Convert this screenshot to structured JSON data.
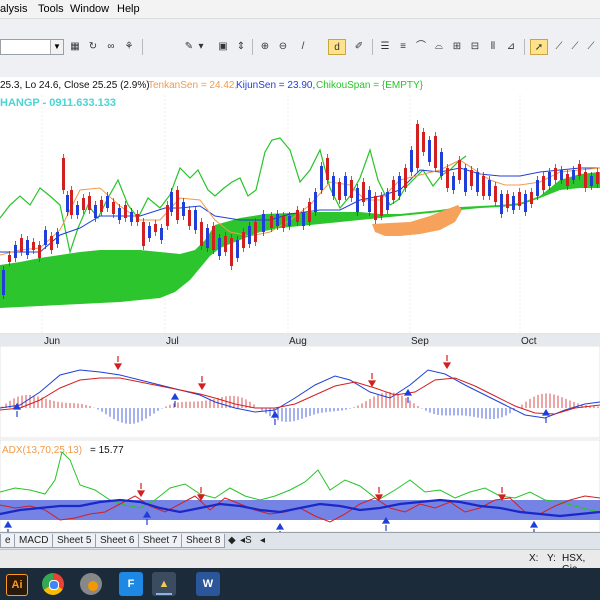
{
  "menu": [
    "alysis",
    "Tools",
    "Window",
    "Help"
  ],
  "toolbar": {
    "icons": [
      "money-icon",
      "refresh-icon",
      "eyeglasses-icon",
      "chart-style-icon",
      "pen-color-icon",
      "chevron-down-icon",
      "zoom-icon",
      "scroll-icon",
      "zoom-fit-icon",
      "zoom-out-icon",
      "italic-icon",
      "draw-line-icon",
      "bar-style-icon",
      "list-icon",
      "horizontal-lines-icon",
      "arc-icon",
      "grid-icon",
      "indicator-icon",
      "bars-icon",
      "triangle-icon",
      "cursor-icon",
      "trendline-icon",
      "diagonal-icon",
      "diagonal2-icon",
      "diagonal3-icon"
    ]
  },
  "chart": {
    "info_prefix": "25.3, Lo 24.6, Close 25.25 (2.9%)",
    "tenkan_label": "TenkanSen = 24.42,",
    "kijun_label": "KijunSen = 23.90,",
    "chikou_label": "ChikouSpan = {EMPTY}",
    "watermark": "HANGP - 0911.633.133",
    "adx_label": "ADX(13,70,25,13)",
    "adx_value": "= 15.77",
    "months": [
      "Jun",
      "Jul",
      "Aug",
      "Sep",
      "Oct"
    ],
    "colors": {
      "tenkan": "#f2994a",
      "kijun": "#1f3fd8",
      "chikou": "#27c427",
      "cloud": "#33cc33",
      "cloud_alt": "#f7a25a",
      "up": "#1f3fd8",
      "down": "#d21f1f",
      "band": "#5d6de0"
    }
  },
  "sheets": {
    "tabs": [
      "e",
      "MACD",
      "Sheet 5",
      "Sheet 6",
      "Sheet 7",
      "Sheet 8"
    ],
    "nav": [
      "◆",
      "◂S",
      "◂"
    ]
  },
  "status": {
    "x": "X:",
    "y": "Y:",
    "market": "HSX, Gia"
  },
  "taskbar": {
    "apps": [
      "Ai",
      "chrome",
      "photos",
      "F",
      "drive",
      "W"
    ]
  }
}
